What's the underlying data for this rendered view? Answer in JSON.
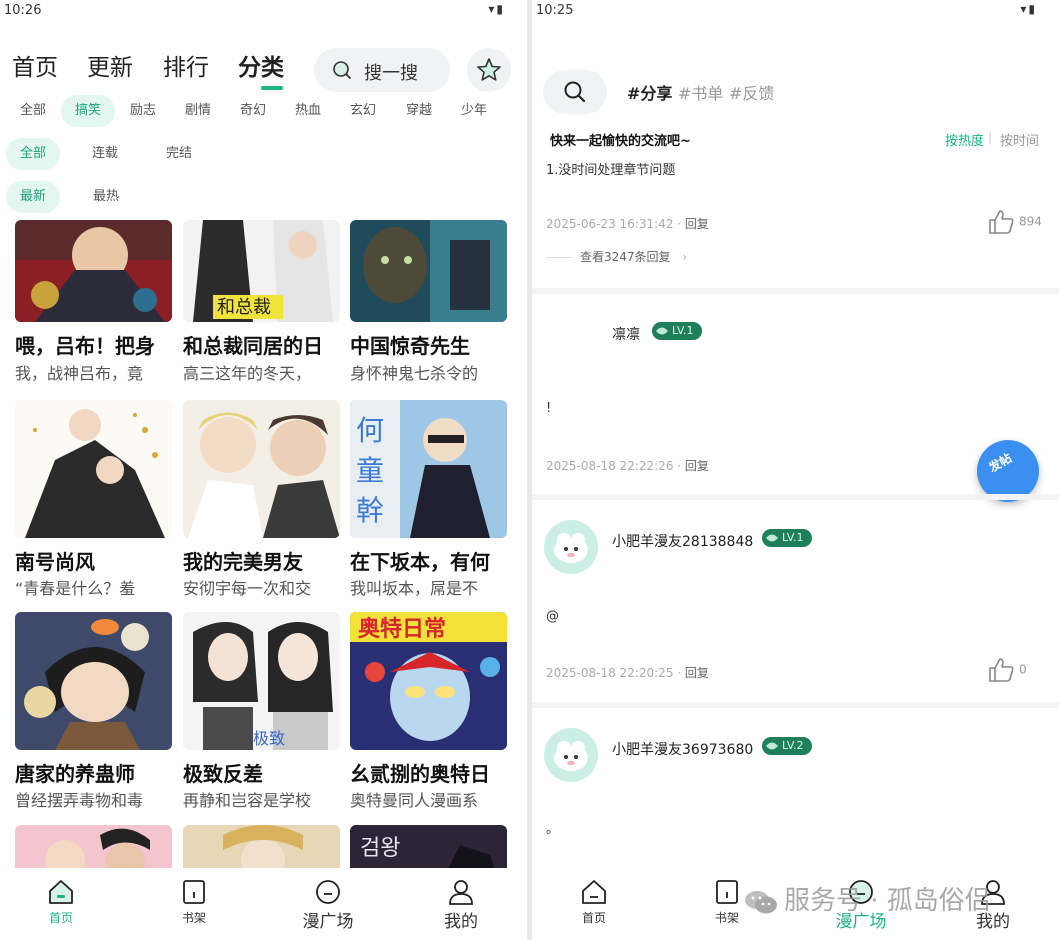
{
  "left": {
    "status_time": "10:26",
    "main_tabs": [
      "首页",
      "更新",
      "排行",
      "分类"
    ],
    "search_placeholder": "搜一搜",
    "genres": [
      "全部",
      "搞笑",
      "励志",
      "剧情",
      "奇幻",
      "热血",
      "玄幻",
      "穿越",
      "少年"
    ],
    "status_filter": [
      "全部",
      "连载",
      "完结"
    ],
    "sort_filter": [
      "最新",
      "最热"
    ],
    "comics": [
      {
        "title": "喂，吕布！把身",
        "desc": "我，战神吕布，竟"
      },
      {
        "title": "和总裁同居的日",
        "desc": "高三这年的冬天，"
      },
      {
        "title": "中国惊奇先生",
        "desc": "身怀神鬼七杀令的"
      },
      {
        "title": "南号尚风",
        "desc": "“青春是什么？羞"
      },
      {
        "title": "我的完美男友",
        "desc": "安彻宇每一次和交"
      },
      {
        "title": "在下坂本，有何",
        "desc": "我叫坂本，屌是不"
      },
      {
        "title": "唐家的养蛊师",
        "desc": "曾经摆弄毒物和毒"
      },
      {
        "title": "极致反差",
        "desc": "再静和岂容是学校"
      },
      {
        "title": "幺贰捌的奥特日",
        "desc": "奥特曼同人漫画系"
      }
    ],
    "nav": [
      "首页",
      "书架",
      "漫广场",
      "我的"
    ]
  },
  "right": {
    "status_time": "10:25",
    "hashtags": [
      "#分享",
      "#书单",
      "#反馈"
    ],
    "top_post": {
      "title": "快来一起愉快的交流吧~",
      "sort_hot": "按热度",
      "sort_sep": "|",
      "sort_time": "按时间",
      "body": "1.没时间处理章节问题",
      "time": "2025-06-23 16:31:42",
      "reply": "回复",
      "likes": "894",
      "view_replies": "查看3247条回复"
    },
    "posts": [
      {
        "user": "凛凛",
        "level": "LV.1",
        "body": "!",
        "time": "2025-08-18 22:22:26",
        "reply": "回复",
        "likes": ""
      },
      {
        "user": "小肥羊漫友28138848",
        "level": "LV.1",
        "body": "@",
        "time": "2025-08-18 22:20:25",
        "reply": "回复",
        "likes": "0"
      },
      {
        "user": "小肥羊漫友36973680",
        "level": "LV.2",
        "body": "。",
        "time": "",
        "reply": "",
        "likes": ""
      }
    ],
    "fab_label": "发帖",
    "nav": [
      "首页",
      "书架",
      "漫广场",
      "我的"
    ],
    "watermark": "服务号 · 孤岛俗侣"
  },
  "colors": {
    "accent": "#1fb386",
    "chip_bg": "#e3f6ef",
    "fab": "#3a8ff0"
  }
}
